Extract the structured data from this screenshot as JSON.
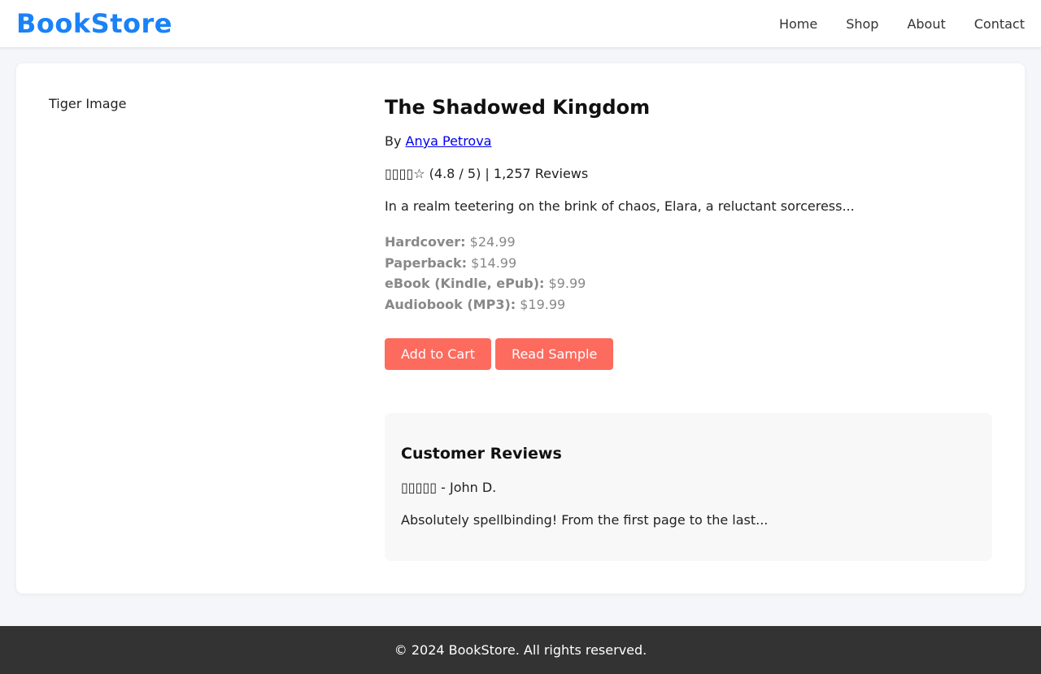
{
  "header": {
    "logo": "BookStore",
    "nav": [
      "Home",
      "Shop",
      "About",
      "Contact"
    ]
  },
  "book": {
    "image_alt": "Tiger Image",
    "title": "The Shadowed Kingdom",
    "by_label": "By",
    "author": "Anya Petrova",
    "rating_stars": "▯▯▯▯☆",
    "rating_text": "(4.8 / 5) | 1,257 Reviews",
    "synopsis": "In a realm teetering on the brink of chaos, Elara, a reluctant sorceress...",
    "formats": [
      {
        "label": "Hardcover:",
        "price": "$24.99"
      },
      {
        "label": "Paperback:",
        "price": "$14.99"
      },
      {
        "label": "eBook (Kindle, ePub):",
        "price": "$9.99"
      },
      {
        "label": "Audiobook (MP3):",
        "price": "$19.99"
      }
    ],
    "buttons": {
      "add_to_cart": "Add to Cart",
      "read_sample": "Read Sample"
    }
  },
  "reviews": {
    "heading": "Customer Reviews",
    "items": [
      {
        "stars": "▯▯▯▯▯",
        "author": "- John D.",
        "text": "Absolutely spellbinding! From the first page to the last..."
      }
    ]
  },
  "footer": {
    "text": "© 2024 BookStore. All rights reserved."
  },
  "colors": {
    "brand": "#1a82f7",
    "button": "#fd6b5f",
    "footer_bg": "#333333",
    "page_bg": "#f4f6f9"
  }
}
